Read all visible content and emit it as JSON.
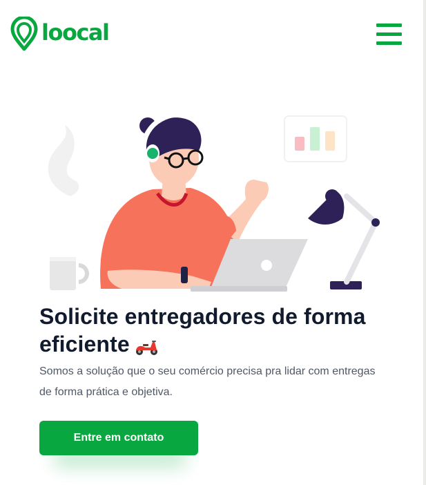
{
  "brand": {
    "name": "loocal",
    "color": "#09a73f"
  },
  "header": {
    "menu_icon": "hamburger-menu-icon"
  },
  "hero": {
    "title": "Solicite entregadores de forma eficiente",
    "title_emoji_icon": "scooter-icon",
    "description": "Somos a solução que o seu comércio precisa pra lidar com entregas de forma prática e objetiva.",
    "cta_label": "Entre em contato"
  },
  "illustration": {
    "icons": [
      "person-with-headset",
      "laptop-icon",
      "coffee-mug-icon",
      "desk-lamp-icon",
      "bar-chart-icon"
    ]
  },
  "colors": {
    "heading": "#121a2d",
    "text": "#4f5866",
    "accent": "#09a73f"
  }
}
